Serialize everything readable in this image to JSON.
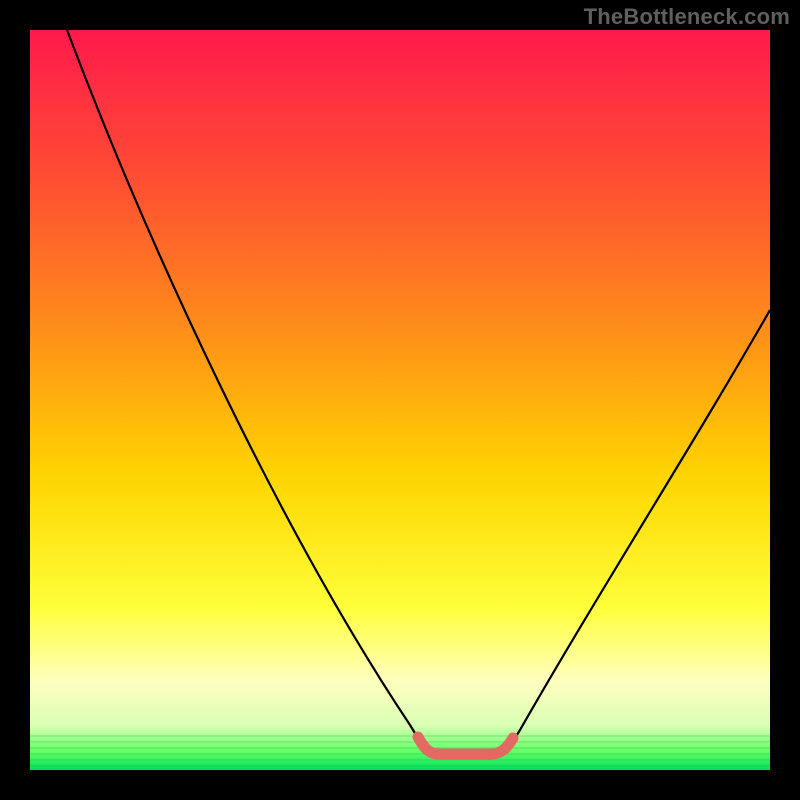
{
  "watermark": {
    "text": "TheBottleneck.com"
  },
  "colors": {
    "frame": "#000000",
    "watermark": "#5f5f5f",
    "curve": "#000000",
    "highlight": "#e26a63",
    "gradient_stops": [
      {
        "offset": 0.0,
        "color": "#ff1a4b"
      },
      {
        "offset": 0.2,
        "color": "#ff4d33"
      },
      {
        "offset": 0.4,
        "color": "#ff8c1a"
      },
      {
        "offset": 0.6,
        "color": "#ffd400"
      },
      {
        "offset": 0.78,
        "color": "#ffff3a"
      },
      {
        "offset": 0.88,
        "color": "#ffffbf"
      },
      {
        "offset": 0.94,
        "color": "#d9ffb3"
      },
      {
        "offset": 0.975,
        "color": "#66ff66"
      },
      {
        "offset": 1.0,
        "color": "#00e05a"
      }
    ]
  },
  "chart_data": {
    "type": "line",
    "title": "",
    "xlabel": "",
    "ylabel": "",
    "xlim": [
      0,
      100
    ],
    "ylim": [
      0,
      100
    ],
    "grid": false,
    "legend": false,
    "series": [
      {
        "name": "bottleneck-curve",
        "x": [
          5,
          15,
          25,
          35,
          45,
          52,
          55,
          58,
          62,
          65,
          75,
          85,
          95,
          100
        ],
        "y": [
          100,
          80,
          60,
          40,
          20,
          5,
          2,
          2,
          2,
          5,
          20,
          38,
          55,
          63
        ]
      }
    ],
    "annotations": [
      {
        "name": "flat-minimum-highlight",
        "x_range": [
          54,
          65
        ],
        "y": 2
      }
    ]
  }
}
